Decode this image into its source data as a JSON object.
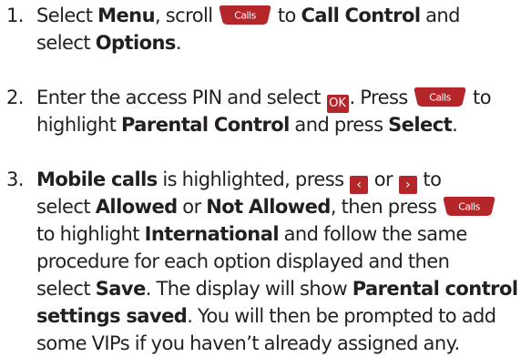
{
  "steps": [
    {
      "number": "1.",
      "lines": [
        [
          "Select ",
          {
            "b": "Menu"
          },
          ", scroll ",
          {
            "key": "calls"
          },
          " to ",
          {
            "b": "Call Control"
          },
          " and"
        ],
        [
          "select ",
          {
            "b": "Options"
          },
          "."
        ]
      ]
    },
    {
      "number": "2.",
      "lines": [
        [
          "Enter the access PIN and select ",
          {
            "key": "ok"
          },
          ". Press ",
          {
            "key": "calls"
          },
          " to"
        ],
        [
          "highlight ",
          {
            "b": "Parental Control"
          },
          " and press ",
          {
            "b": "Select"
          },
          "."
        ]
      ]
    },
    {
      "number": "3.",
      "lines": [
        [
          {
            "b": "Mobile calls"
          },
          " is highlighted, press ",
          {
            "key": "left"
          },
          " or ",
          {
            "key": "right"
          },
          " to"
        ],
        [
          "select ",
          {
            "b": "Allowed"
          },
          " or ",
          {
            "b": "Not Allowed"
          },
          ", then press ",
          {
            "key": "calls"
          }
        ],
        [
          "to highlight ",
          {
            "b": "International"
          },
          " and follow the same"
        ],
        [
          "procedure for each option displayed and then"
        ],
        [
          "select ",
          {
            "b": "Save"
          },
          ". The display will show ",
          {
            "b": "Parental control"
          }
        ],
        [
          {
            "b": "settings saved"
          },
          ". You will then be prompted to add"
        ],
        [
          "some VIPs if you haven’t already assigned any."
        ]
      ]
    }
  ],
  "keys": {
    "calls": {
      "label": "Calls",
      "icon": "calls-key-icon",
      "color": "#b5262b"
    },
    "ok": {
      "label": "OK",
      "icon": "ok-key-icon",
      "color": "#b5262b"
    },
    "left": {
      "label": "‹",
      "icon": "left-arrow-key-icon",
      "color": "#b5262b"
    },
    "right": {
      "label": "›",
      "icon": "right-arrow-key-icon",
      "color": "#b5262b"
    }
  }
}
